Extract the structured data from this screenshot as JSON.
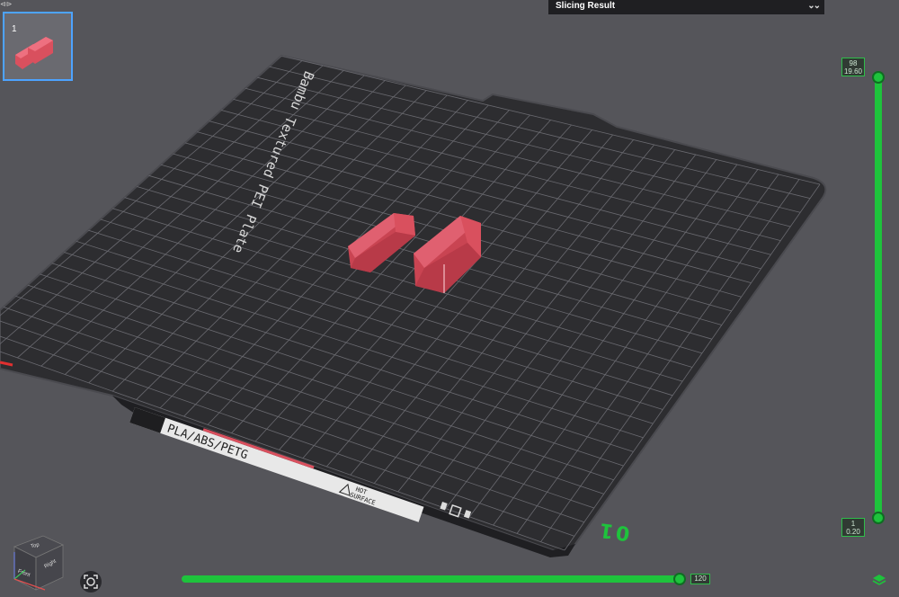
{
  "window": {
    "corner_mark": "⊲⊳"
  },
  "plate_list": {
    "items": [
      {
        "index": "1",
        "selected": true
      }
    ]
  },
  "slicing_result": {
    "title": "Slicing Result",
    "toggle_icon": "double-chevron-down-icon"
  },
  "build_plate": {
    "name_text": "Bambu Textured PEI Plate",
    "filament_text": "PLA/ABS/PETG",
    "warning_text_line1": "HOT",
    "warning_text_line2": "SURFACE",
    "plate_number": "01"
  },
  "layer_slider": {
    "top_layer": "98",
    "top_height": "19.60",
    "bottom_layer": "1",
    "bottom_height": "0.20"
  },
  "move_slider": {
    "value": "120"
  },
  "view_cube": {
    "top_label": "Top",
    "front_label": "Front",
    "right_label": "Right"
  },
  "colors": {
    "accent_green": "#1ec33c",
    "selection_blue": "#4da3ff",
    "model_red": "#d9505e"
  }
}
